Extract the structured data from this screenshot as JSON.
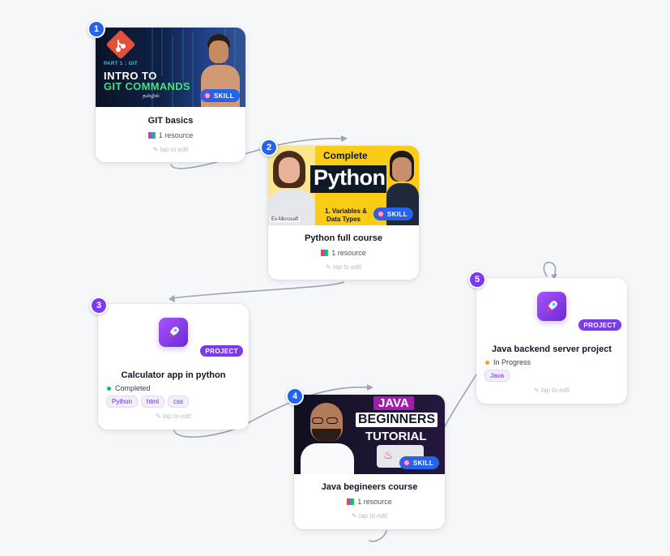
{
  "cards": {
    "git": {
      "number": "1",
      "badge": "SKILL",
      "title": "GIT basics",
      "resources": "1 resource",
      "hint": "tap to edit",
      "thumbnail": {
        "kicker": "PART 1 : GIT",
        "line1": "INTRO TO",
        "line2": "GIT COMMANDS",
        "language": "தமிழில்"
      }
    },
    "python": {
      "number": "2",
      "badge": "SKILL",
      "title": "Python full course",
      "resources": "1 resource",
      "hint": "tap to edit",
      "thumbnail": {
        "line1": "Complete",
        "line2": "Python",
        "subtitle1": "1. Variables &",
        "subtitle2": "Data Types",
        "corner": "Ex-Microsoft"
      }
    },
    "calculator": {
      "number": "3",
      "badge": "PROJECT",
      "title": "Calculator app in python",
      "status": "Completed",
      "status_color": "#10b981",
      "tags": [
        "Python",
        "html",
        "css"
      ],
      "hint": "tap to edit",
      "icon": "rocket-icon"
    },
    "java_course": {
      "number": "4",
      "badge": "SKILL",
      "title": "Java begineers course",
      "resources": "1 resource",
      "hint": "tap to edit",
      "thumbnail": {
        "line1": "JAVA",
        "line2": "BEGINNERS",
        "line3": "TUTORIAL"
      }
    },
    "java_backend": {
      "number": "5",
      "badge": "PROJECT",
      "title": "Java backend server project",
      "status": "In Progress",
      "status_color": "#f59e0b",
      "tags": [
        "Java"
      ],
      "hint": "tap to edit",
      "icon": "rocket-icon"
    }
  },
  "colors": {
    "skill": "#2563eb",
    "project": "#7c3aed",
    "connector": "#9aa5b4",
    "background": "#f6f7f9"
  }
}
